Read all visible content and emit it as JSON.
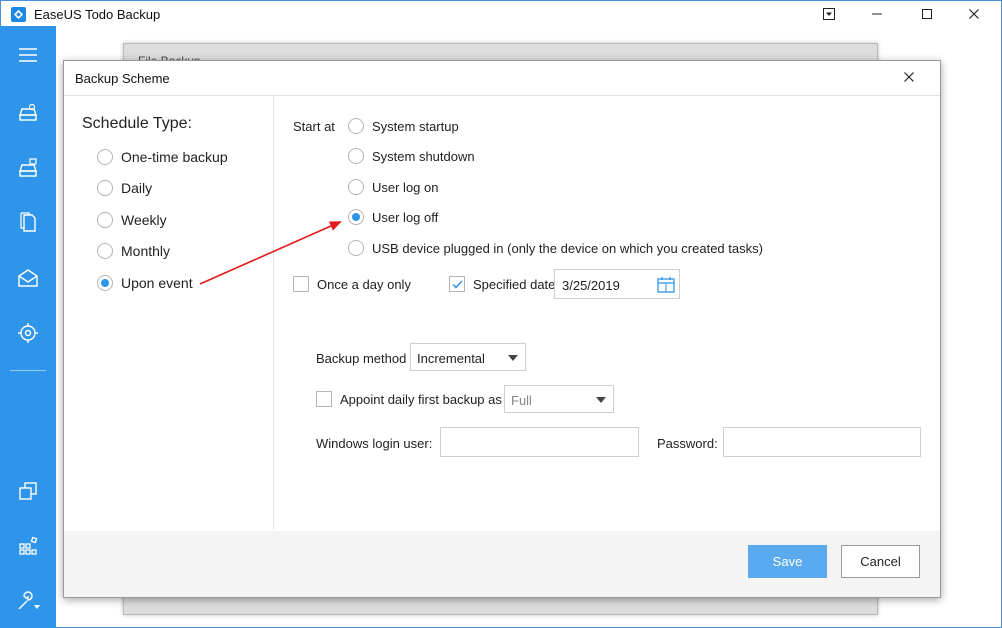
{
  "app": {
    "title": "EaseUS Todo Backup"
  },
  "under_window": {
    "title": "File Backup"
  },
  "dialog": {
    "title": "Backup Scheme",
    "schedule_type_label": "Schedule Type:",
    "schedule_types": [
      {
        "label": "One-time backup",
        "checked": false
      },
      {
        "label": "Daily",
        "checked": false
      },
      {
        "label": "Weekly",
        "checked": false
      },
      {
        "label": "Monthly",
        "checked": false
      },
      {
        "label": "Upon event",
        "checked": true
      }
    ],
    "start_at_label": "Start at",
    "events": [
      {
        "label": "System startup",
        "checked": false
      },
      {
        "label": "System shutdown",
        "checked": false
      },
      {
        "label": "User log on",
        "checked": false
      },
      {
        "label": "User log off",
        "checked": true
      },
      {
        "label": "USB device plugged in (only the device on which you created tasks)",
        "checked": false
      }
    ],
    "once_a_day_label": "Once a day only",
    "once_a_day_checked": false,
    "specified_date_label": "Specified date",
    "specified_date_checked": true,
    "specified_date_value": "3/25/2019",
    "backup_method_label": "Backup method",
    "backup_method_value": "Incremental",
    "appoint_label": "Appoint daily first backup as",
    "appoint_checked": false,
    "appoint_value": "Full",
    "login_user_label": "Windows login user:",
    "login_user_value": "",
    "password_label": "Password:",
    "password_value": "",
    "save_label": "Save",
    "cancel_label": "Cancel"
  },
  "colors": {
    "accent": "#2f95ea",
    "save_button": "#5aaaf0",
    "annotation_arrow": "#e11b1b"
  },
  "icons": {
    "sidebar": [
      "menu-icon",
      "disk-backup-icon",
      "system-backup-icon",
      "file-backup-icon",
      "mail-backup-icon",
      "smart-backup-icon",
      "clone-icon",
      "apps-icon",
      "tools-icon"
    ],
    "titlebar": [
      "dropdown-menu-icon",
      "minimize-icon",
      "maximize-icon",
      "close-icon"
    ]
  }
}
